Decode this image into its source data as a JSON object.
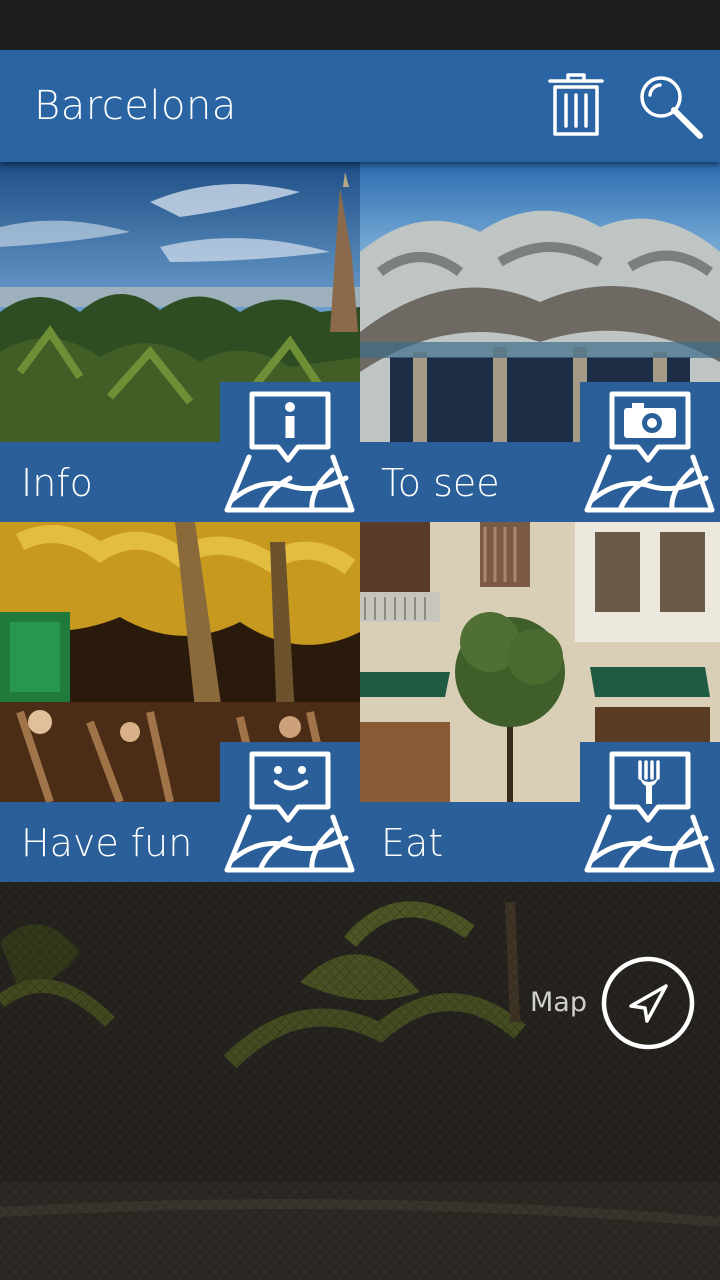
{
  "app_bar": {
    "title": "Barcelona",
    "actions": [
      {
        "name": "trash-icon"
      },
      {
        "name": "search-icon"
      }
    ]
  },
  "tiles": [
    {
      "label": "Info",
      "icon": "info-map-icon"
    },
    {
      "label": "To see",
      "icon": "camera-map-icon"
    },
    {
      "label": "Have fun",
      "icon": "smiley-map-icon"
    },
    {
      "label": "Eat",
      "icon": "fork-map-icon"
    }
  ],
  "map": {
    "label": "Map",
    "icon": "navigation-arrow-icon"
  },
  "colors": {
    "primary": "#2a64a3",
    "tile_strip": "#2a5f99",
    "status_bar": "#1e1e1e"
  }
}
